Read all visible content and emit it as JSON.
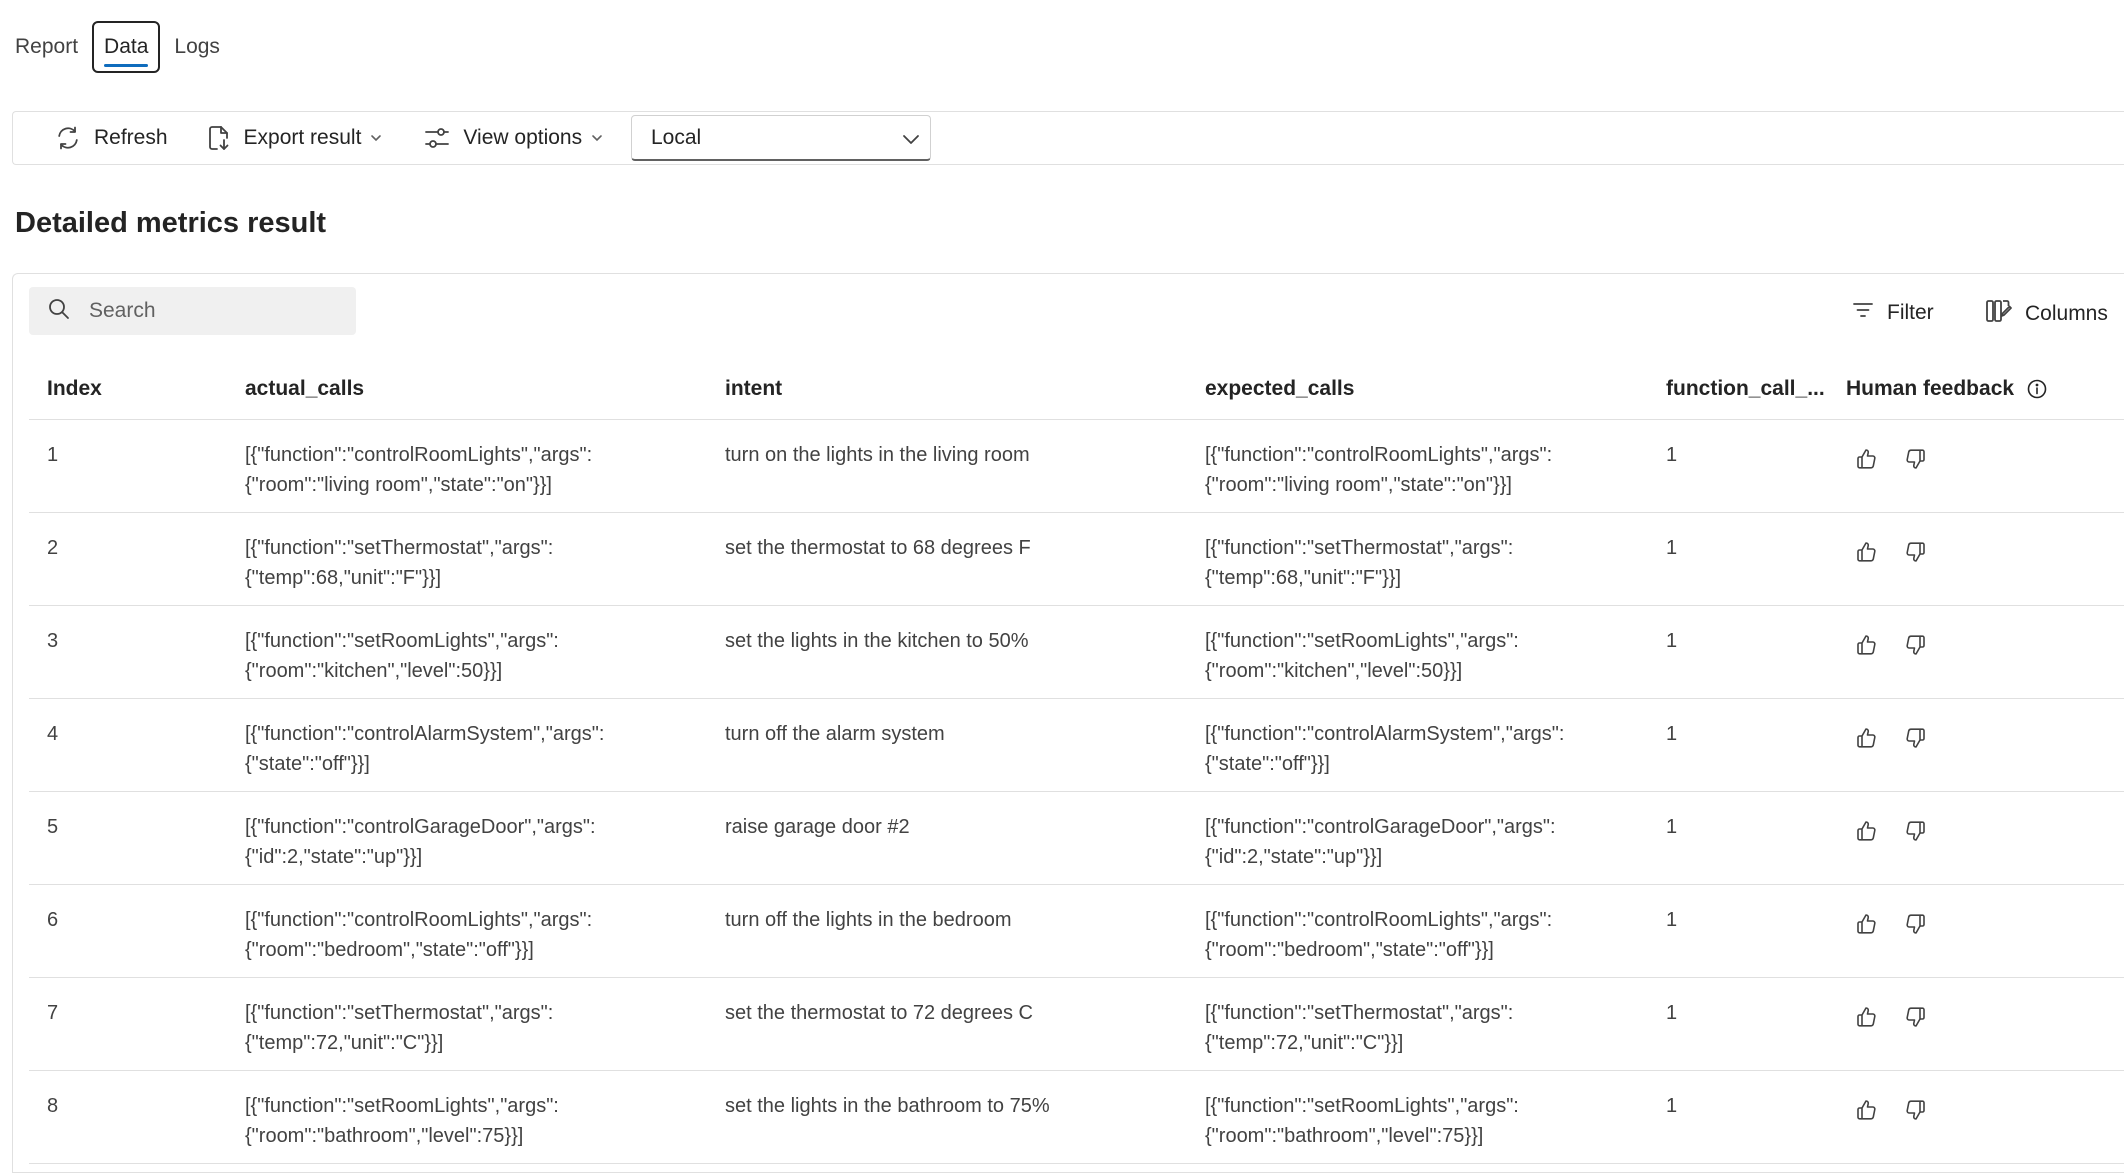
{
  "tabs": [
    {
      "label": "Report"
    },
    {
      "label": "Data"
    },
    {
      "label": "Logs"
    }
  ],
  "selected_tab": "Data",
  "toolbar": {
    "refresh_label": "Refresh",
    "export_label": "Export result",
    "view_options_label": "View options",
    "run_select_value": "Local"
  },
  "page_title": "Detailed metrics result",
  "search": {
    "placeholder": "Search"
  },
  "filter_label": "Filter",
  "columns_label": "Columns",
  "table": {
    "headers": {
      "index": "Index",
      "actual_calls": "actual_calls",
      "intent": "intent",
      "expected_calls": "expected_calls",
      "function_call": "function_call_...",
      "human_feedback": "Human feedback"
    },
    "rows": [
      {
        "index": "1",
        "actual_calls": "[{\"function\":\"controlRoomLights\",\"args\":\n{\"room\":\"living room\",\"state\":\"on\"}}]",
        "intent": "turn on the lights in the living room",
        "expected_calls": "[{\"function\":\"controlRoomLights\",\"args\":\n{\"room\":\"living room\",\"state\":\"on\"}}]",
        "function_call": "1"
      },
      {
        "index": "2",
        "actual_calls": "[{\"function\":\"setThermostat\",\"args\":\n{\"temp\":68,\"unit\":\"F\"}}]",
        "intent": "set the thermostat to 68 degrees F",
        "expected_calls": "[{\"function\":\"setThermostat\",\"args\":\n{\"temp\":68,\"unit\":\"F\"}}]",
        "function_call": "1"
      },
      {
        "index": "3",
        "actual_calls": "[{\"function\":\"setRoomLights\",\"args\":\n{\"room\":\"kitchen\",\"level\":50}}]",
        "intent": "set the lights in the kitchen to 50%",
        "expected_calls": "[{\"function\":\"setRoomLights\",\"args\":\n{\"room\":\"kitchen\",\"level\":50}}]",
        "function_call": "1"
      },
      {
        "index": "4",
        "actual_calls": "[{\"function\":\"controlAlarmSystem\",\"args\":\n{\"state\":\"off\"}}]",
        "intent": "turn off the alarm system",
        "expected_calls": "[{\"function\":\"controlAlarmSystem\",\"args\":\n{\"state\":\"off\"}}]",
        "function_call": "1"
      },
      {
        "index": "5",
        "actual_calls": "[{\"function\":\"controlGarageDoor\",\"args\":\n{\"id\":2,\"state\":\"up\"}}]",
        "intent": "raise garage door #2",
        "expected_calls": "[{\"function\":\"controlGarageDoor\",\"args\":\n{\"id\":2,\"state\":\"up\"}}]",
        "function_call": "1"
      },
      {
        "index": "6",
        "actual_calls": "[{\"function\":\"controlRoomLights\",\"args\":\n{\"room\":\"bedroom\",\"state\":\"off\"}}]",
        "intent": "turn off the lights in the bedroom",
        "expected_calls": "[{\"function\":\"controlRoomLights\",\"args\":\n{\"room\":\"bedroom\",\"state\":\"off\"}}]",
        "function_call": "1"
      },
      {
        "index": "7",
        "actual_calls": "[{\"function\":\"setThermostat\",\"args\":\n{\"temp\":72,\"unit\":\"C\"}}]",
        "intent": "set the thermostat to 72 degrees C",
        "expected_calls": "[{\"function\":\"setThermostat\",\"args\":\n{\"temp\":72,\"unit\":\"C\"}}]",
        "function_call": "1"
      },
      {
        "index": "8",
        "actual_calls": "[{\"function\":\"setRoomLights\",\"args\":\n{\"room\":\"bathroom\",\"level\":75}}]",
        "intent": "set the lights in the bathroom to 75%",
        "expected_calls": "[{\"function\":\"setRoomLights\",\"args\":\n{\"room\":\"bathroom\",\"level\":75}}]",
        "function_call": "1"
      }
    ]
  },
  "icons": {
    "refresh": "refresh-icon",
    "export": "document-arrow-down-icon",
    "view_options": "options-sliders-icon",
    "chevron": "chevron-down-icon",
    "search": "search-icon",
    "filter": "filter-icon",
    "columns": "columns-edit-icon",
    "info": "info-icon",
    "thumb_up": "thumb-up-icon",
    "thumb_down": "thumb-down-icon"
  },
  "colors": {
    "accent": "#0f6cbd",
    "text": "#242424",
    "border": "#e0e0e0",
    "search_bg": "#f0f0f0"
  }
}
